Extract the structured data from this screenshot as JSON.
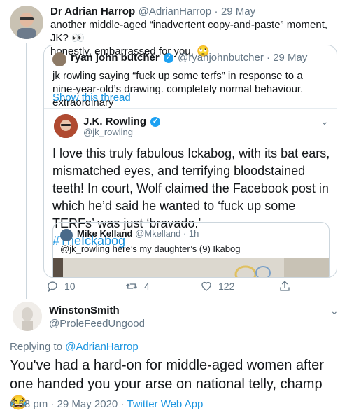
{
  "tweet1": {
    "name": "Dr Adrian Harrop",
    "handle": "@AdrianHarrop",
    "sep": "·",
    "date": "29 May",
    "text_line1": "another middle-aged “inadvertent copy-and-paste” moment, JK? 👀",
    "text_line2": "honestly, embarrassed for you. 🙄"
  },
  "quote1": {
    "name": "ryan john butcher",
    "handle": "@ryanjohnbutcher",
    "sep": "·",
    "date": "29 May",
    "text": "jk rowling saying “fuck up some terfs” in response to a nine-year-old’s drawing. completely normal behaviour. extraordinary",
    "show_thread": "Show this thread"
  },
  "jk": {
    "name": "J.K. Rowling",
    "handle": "@jk_rowling",
    "text": "I love this truly fabulous Ickabog, with its bat ears, mismatched eyes, and terrifying bloodstained teeth! In court, Wolf claimed the Facebook post in which he’d said he wanted to ‘fuck up some TERFs’ was just ‘bravado.’",
    "hashtag": "#TheIckabog"
  },
  "quote2": {
    "name": "Mike Kelland",
    "handle": "@Mkelland",
    "sep": "·",
    "time": "1h",
    "text": "@jk_rowling here’s my daughter’s (9) Ikabog"
  },
  "actions": {
    "replies": "10",
    "retweets": "4",
    "likes": "122"
  },
  "tweet2": {
    "name": "WinstonSmith",
    "handle": "@ProleFeedUngood",
    "replying_prefix": "Replying to ",
    "replying_to": "@AdrianHarrop",
    "text": "You've had a hard-on for middle-aged women after one handed you your arse on national telly, champ 😂",
    "time": "6:58 pm",
    "sep1": "·",
    "date": "29 May 2020",
    "sep2": "·",
    "source": "Twitter Web App"
  },
  "colors": {
    "link": "#1b95e0",
    "verified": "#1da1f2",
    "muted": "#657786",
    "border": "#ccd6dd"
  },
  "icons": [
    "reply-icon",
    "retweet-icon",
    "like-icon",
    "share-icon",
    "chevron-down-icon",
    "verified-badge-icon"
  ]
}
